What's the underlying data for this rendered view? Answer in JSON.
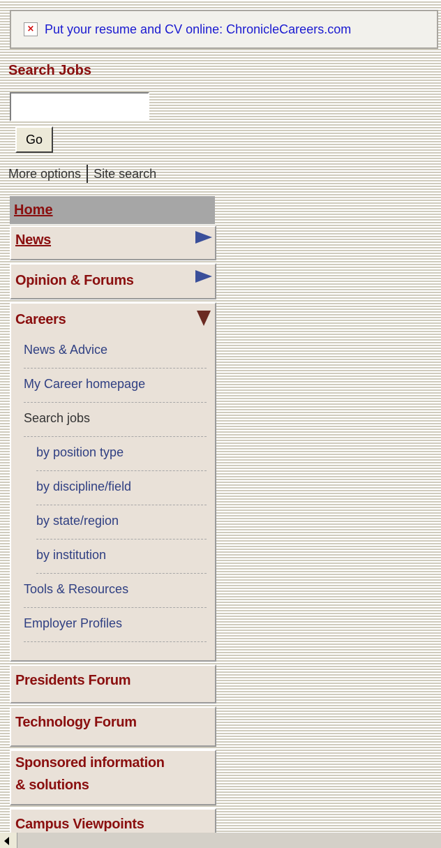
{
  "banner": {
    "broken_image_glyph": "×",
    "text": "Put your resume and CV online: ChronicleCareers.com"
  },
  "search": {
    "title": "Search Jobs",
    "input_value": "",
    "go_label": "Go",
    "more_options": "More options",
    "site_search": "Site search"
  },
  "nav": {
    "home": "Home",
    "news": "News",
    "opinion": "Opinion & Forums",
    "careers": "Careers",
    "careers_sub": [
      "News & Advice",
      "My Career homepage",
      "Search jobs",
      "by position type",
      "by discipline/field",
      "by state/region",
      "by institution",
      "Tools & Resources",
      "Employer Profiles"
    ],
    "presidents": "Presidents Forum",
    "technology": "Technology Forum",
    "sponsored_line1": "Sponsored information",
    "sponsored_line2": "& solutions",
    "campus": "Campus Viewpoints"
  },
  "colors": {
    "nav_text": "#8a0f0f",
    "link_blue": "#1a1ad0",
    "sub_link": "#2f3f82",
    "arrow_blue": "#3a4f9a",
    "arrow_brown": "#6b2a22"
  }
}
